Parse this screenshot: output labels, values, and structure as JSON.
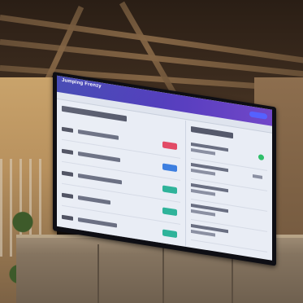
{
  "dashboard": {
    "header": {
      "brand": "Jumping Frenzy"
    },
    "left_panel": {
      "rows": [
        {
          "status": "red"
        },
        {
          "status": "blue"
        },
        {
          "status": "green"
        },
        {
          "status": "green"
        },
        {
          "status": "green"
        }
      ]
    },
    "colors": {
      "header_start": "#3a3fb0",
      "header_end": "#7247c8",
      "status_red": "#e24b66",
      "status_blue": "#3d7fe0",
      "status_green": "#2fb39a",
      "online_dot": "#2fbf6a"
    }
  }
}
